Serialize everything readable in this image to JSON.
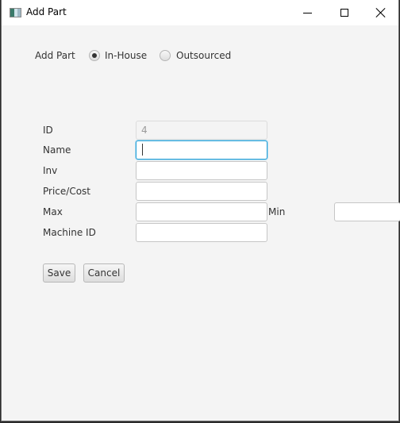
{
  "window": {
    "title": "Add Part",
    "controls": [
      "minimize",
      "maximize",
      "close"
    ]
  },
  "header": {
    "label": "Add Part",
    "source_options": [
      {
        "label": "In-House",
        "selected": true
      },
      {
        "label": "Outsourced",
        "selected": false
      }
    ]
  },
  "form": {
    "id": {
      "label": "ID",
      "value": "4",
      "disabled": true
    },
    "name": {
      "label": "Name",
      "value": "",
      "focused": true
    },
    "inv": {
      "label": "Inv",
      "value": ""
    },
    "price": {
      "label": "Price/Cost",
      "value": ""
    },
    "max": {
      "label": "Max",
      "value": ""
    },
    "min": {
      "label": "Min",
      "value": ""
    },
    "machine_id": {
      "label": "Machine ID",
      "value": ""
    }
  },
  "buttons": {
    "save": "Save",
    "cancel": "Cancel"
  },
  "colors": {
    "focus_accent": "#2aa2d8",
    "background": "#f4f4f4"
  }
}
